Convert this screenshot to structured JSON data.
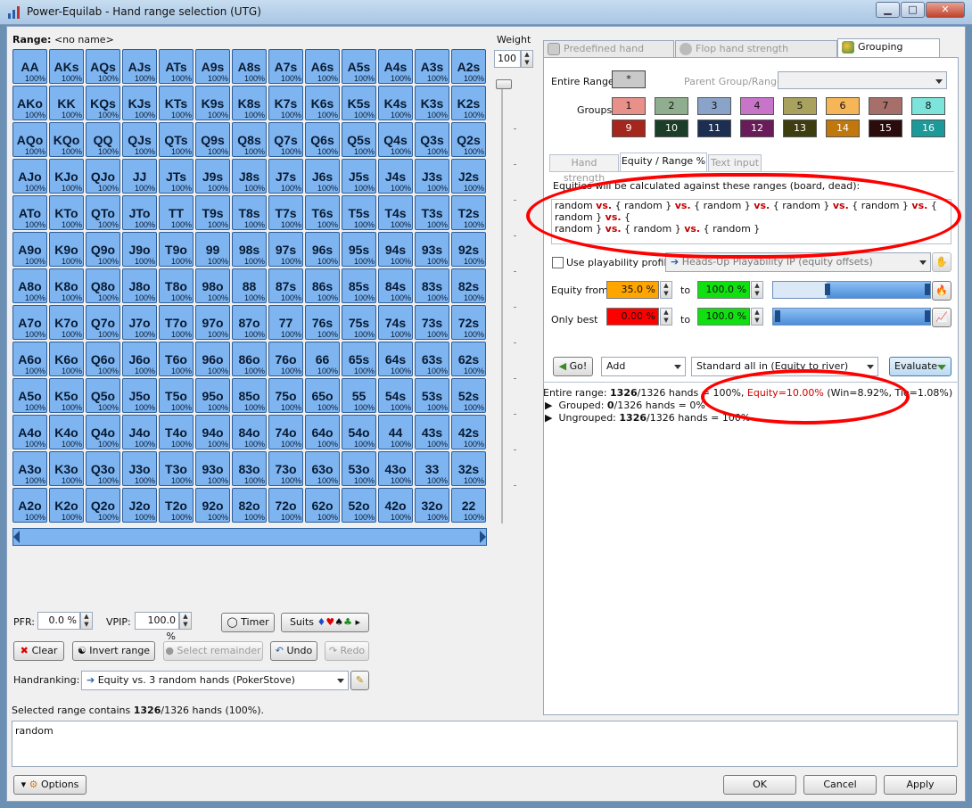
{
  "window": {
    "title": "Power-Equilab - Hand range selection (UTG)",
    "minimize": "▁",
    "maximize": "□",
    "close": "✕"
  },
  "range": {
    "label": "Range:",
    "name": "<no name>"
  },
  "weight": {
    "label": "Weight",
    "value": "100"
  },
  "grid": {
    "ranks": [
      "A",
      "K",
      "Q",
      "J",
      "T",
      "9",
      "8",
      "7",
      "6",
      "5",
      "4",
      "3",
      "2"
    ],
    "percent": "100%"
  },
  "tabs": [
    {
      "label": "Predefined hand ranges"
    },
    {
      "label": "Flop hand strength distribution"
    },
    {
      "label": "Grouping options"
    }
  ],
  "grouping": {
    "entire_range_label": "Entire Range:",
    "entire_range_btn": "*",
    "parent_label": "Parent Group/Range:",
    "groups_label": "Groups:",
    "groups": [
      {
        "n": "1",
        "bg": "#e8908a",
        "fg": "#111"
      },
      {
        "n": "2",
        "bg": "#8fae8f",
        "fg": "#111"
      },
      {
        "n": "3",
        "bg": "#8aa3c8",
        "fg": "#111"
      },
      {
        "n": "4",
        "bg": "#c874c8",
        "fg": "#111"
      },
      {
        "n": "5",
        "bg": "#a8a25e",
        "fg": "#111"
      },
      {
        "n": "6",
        "bg": "#f6b556",
        "fg": "#111"
      },
      {
        "n": "7",
        "bg": "#a66f6a",
        "fg": "#111"
      },
      {
        "n": "8",
        "bg": "#7de4dc",
        "fg": "#111"
      },
      {
        "n": "9",
        "bg": "#a5261c",
        "fg": "#fff"
      },
      {
        "n": "10",
        "bg": "#1c3d28",
        "fg": "#fff"
      },
      {
        "n": "11",
        "bg": "#1c2f52",
        "fg": "#fff"
      },
      {
        "n": "12",
        "bg": "#6a1c5a",
        "fg": "#fff"
      },
      {
        "n": "13",
        "bg": "#3d3d10",
        "fg": "#fff"
      },
      {
        "n": "14",
        "bg": "#c0780c",
        "fg": "#fff"
      },
      {
        "n": "15",
        "bg": "#2a0c0c",
        "fg": "#fff"
      },
      {
        "n": "16",
        "bg": "#1c9a9a",
        "fg": "#fff"
      }
    ]
  },
  "subtabs": [
    {
      "label": "Hand strength"
    },
    {
      "label": "Equity / Range %"
    },
    {
      "label": "Text input"
    }
  ],
  "equity": {
    "hint": "Equities will be calculated against these ranges (board, dead):",
    "line1a": "random ",
    "line1vs": "vs.",
    "line1b": " { random } ",
    "line1c": " { random } ",
    "line1d": " { random } ",
    "line1e": " { random } ",
    "line1f": " { random } ",
    "line1g": " {",
    "line2a": "random } ",
    "line2b": " { random } ",
    "line2c": " { random }",
    "use_profile_label": "Use playability profile:",
    "profile": "Heads-Up Playability IP  (equity offsets)",
    "equity_from_label": "Equity from",
    "equity_from": "35.0 %",
    "to1": "to",
    "equity_to": "100.0 %",
    "only_best_label": "Only best",
    "only_best_from": "0.00 %",
    "to2": "to",
    "only_best_to": "100.0 %"
  },
  "actions": {
    "go": "Go!",
    "mode": "Add",
    "method": "Standard all in (Equity to river)",
    "evaluate": "Evaluate"
  },
  "results": {
    "entire_prefix": "Entire range: ",
    "entire_hands": "1326",
    "entire_rest": "/1326 hands = 100%, ",
    "equity": "Equity=10.00%",
    "winline": " (Win=8.92%, Tie=1.08%)",
    "grouped_prefix": "Grouped: ",
    "grouped_hands": "0",
    "grouped_rest": "/1326 hands = 0%",
    "ungrouped_prefix": "Ungrouped: ",
    "ungrouped_hands": "1326",
    "ungrouped_rest": "/1326 hands = 100%"
  },
  "controls": {
    "pfr_label": "PFR:",
    "pfr": "0.0 %",
    "vpip_label": "VPIP:",
    "vpip": "100.0 %",
    "timer": "Timer",
    "suits": "Suits",
    "clear": "Clear",
    "invert": "Invert range",
    "select_remainder": "Select remainder",
    "undo": "Undo",
    "redo": "Redo",
    "handranking_label": "Handranking:",
    "handranking": "Equity vs. 3 random hands (PokerStove)",
    "selected_prefix": "Selected range contains ",
    "selected_hands": "1326",
    "selected_rest": "/1326 hands (100%).",
    "range_text": "random"
  },
  "footer": {
    "options": "Options",
    "ok": "OK",
    "cancel": "Cancel",
    "apply": "Apply"
  },
  "colors": {
    "cell": "#7eb4ef",
    "equity_red": "#d00000",
    "eq_from_bg": "#ffa500",
    "eq_to_bg": "#10e010",
    "best_from_bg": "#ff0000"
  }
}
